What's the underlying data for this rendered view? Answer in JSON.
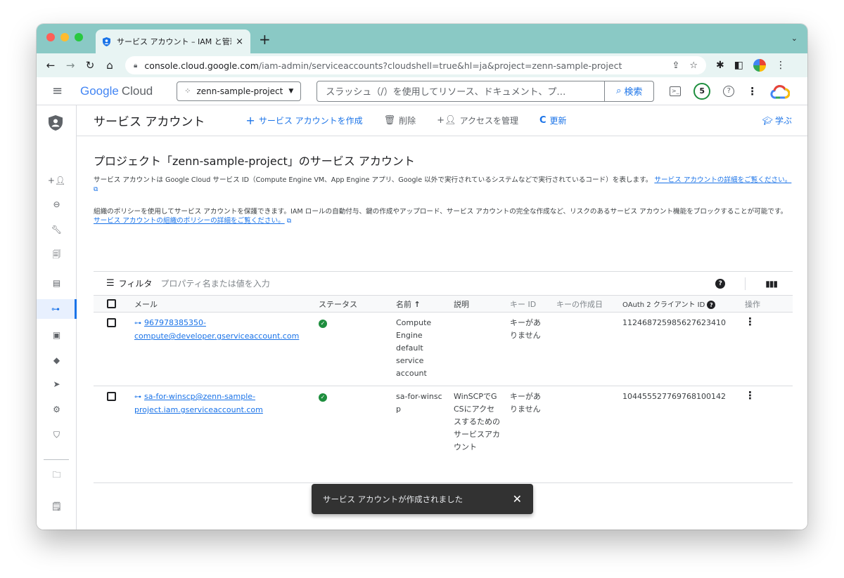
{
  "browser": {
    "tab_title": "サービス アカウント – IAM と管理",
    "tab_close": "×",
    "new_tab": "+",
    "url_host": "console.cloud.google.com",
    "url_path": "/iam-admin/serviceaccounts?cloudshell=true&hl=ja&project=zenn-sample-project"
  },
  "header": {
    "logo_google": "Google",
    "logo_cloud": "Cloud",
    "project": "zenn-sample-project",
    "search_placeholder": "スラッシュ（/）を使用してリソース、ドキュメント、プ…",
    "search_button": "検索",
    "notification_count": "5"
  },
  "toolbar": {
    "page_title": "サービス アカウント",
    "create": "サービス アカウントを作成",
    "delete": "削除",
    "manage_access": "アクセスを管理",
    "refresh": "更新",
    "learn": "学ぶ"
  },
  "content": {
    "section_title": "プロジェクト「zenn-sample-project」のサービス アカウント",
    "para1_text": "サービス アカウントは Google Cloud サービス ID（Compute Engine VM、App Engine アプリ、Google 以外で実行されているシステムなどで実行されているコード）を表します。",
    "para1_link": "サービス アカウントの詳細をご覧ください。",
    "para2_text": "組織のポリシーを使用してサービス アカウントを保護できます。IAM ロールの自動付与、鍵の作成やアップロード、サービス アカウントの完全な作成など、リスクのあるサービス アカウント機能をブロックすることが可能です。",
    "para2_link": "サービス アカウントの組織のポリシーの詳細をご覧ください。"
  },
  "filter": {
    "label": "フィルタ",
    "placeholder": "プロパティ名または値を入力"
  },
  "table": {
    "columns": {
      "email": "メール",
      "status": "ステータス",
      "name": "名前",
      "description": "説明",
      "key_id": "キー ID",
      "key_created": "キーの作成日",
      "oauth_id": "OAuth 2 クライアント ID",
      "actions": "操作"
    },
    "rows": [
      {
        "email_line1": "967978385350-",
        "email_line2": "compute@developer.gserviceaccount.com",
        "name": "Compute Engine default service account",
        "description": "",
        "key_id": "キーがありません",
        "key_created": "",
        "oauth_id": "112468725985627623410"
      },
      {
        "email_line1": "sa-for-winscp@zenn-sample-",
        "email_line2": "project.iam.gserviceaccount.com",
        "name": "sa-for-winscp",
        "description": "WinSCPでGCSにアクセスするためのサービスアカウント",
        "key_id": "キーがありません",
        "key_created": "",
        "oauth_id": "104455527769768100142"
      }
    ]
  },
  "toast": {
    "message": "サービス アカウントが作成されました",
    "close": "✕"
  }
}
